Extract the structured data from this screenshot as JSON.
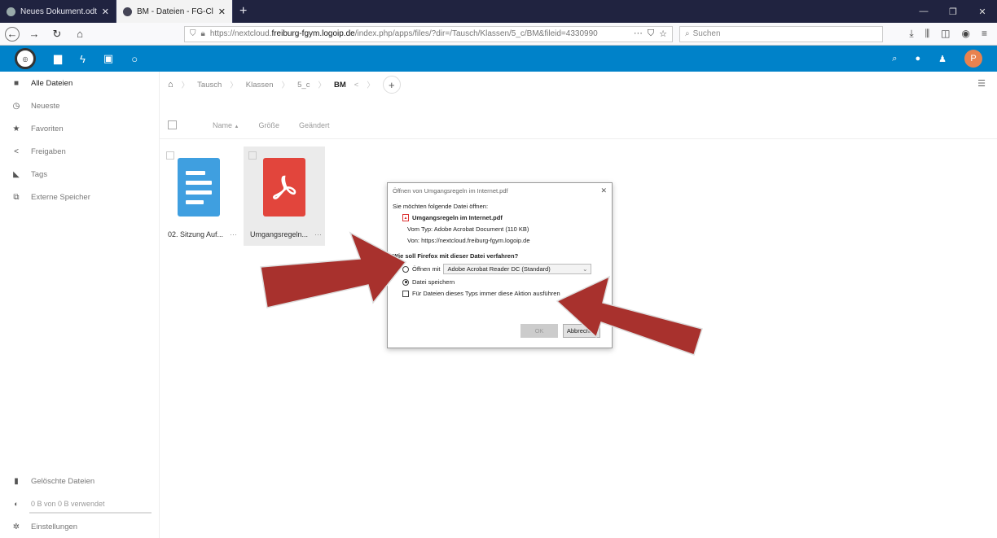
{
  "browser": {
    "tabs": [
      {
        "label": "Neues Dokument.odt - Dateien",
        "close": "✕",
        "active": false
      },
      {
        "label": "BM - Dateien - FG-Cloud",
        "close": "✕",
        "active": true
      }
    ],
    "new_tab": "+",
    "url_prefix": "https://nextcloud.",
    "url_host": "freiburg-fgym.logoip.de",
    "url_path": "/index.php/apps/files/?dir=/Tausch/Klassen/5_c/BM&fileid=4330990",
    "url_more": "···",
    "search_placeholder": "Suchen"
  },
  "sidebar": {
    "items": [
      {
        "label": "Alle Dateien",
        "icon": "folder-icon"
      },
      {
        "label": "Neueste",
        "icon": "clock-icon"
      },
      {
        "label": "Favoriten",
        "icon": "star-icon"
      },
      {
        "label": "Freigaben",
        "icon": "share-icon"
      },
      {
        "label": "Tags",
        "icon": "tag-icon"
      },
      {
        "label": "Externe Speicher",
        "icon": "external-storage-icon"
      }
    ],
    "deleted": "Gelöschte Dateien",
    "quota": "0 B von 0 B verwendet",
    "settings": "Einstellungen"
  },
  "header": {
    "avatar_initial": "P"
  },
  "breadcrumb": {
    "items": [
      "Tausch",
      "Klassen",
      "5_c",
      "BM"
    ],
    "add": "+"
  },
  "list": {
    "col_name": "Name",
    "col_name_sort": "▲",
    "col_size": "Größe",
    "col_modified": "Geändert"
  },
  "files": [
    {
      "name": "02. Sitzung Auf...",
      "dots": "···"
    },
    {
      "name": "Umgangsregeln...",
      "dots": "···"
    }
  ],
  "dialog": {
    "title": "Öffnen von Umgangsregeln im Internet.pdf",
    "close": "✕",
    "intro": "Sie möchten folgende Datei öffnen:",
    "filename": "Umgangsregeln im Internet.pdf",
    "type_line": "Vom Typ: Adobe Acrobat Document (110 KB)",
    "from_line": "Von: https://nextcloud.freiburg-fgym.logoip.de",
    "question": "Wie soll Firefox mit dieser Datei verfahren?",
    "open_with": "Öffnen mit",
    "app_option": "Adobe Acrobat Reader DC (Standard)",
    "save_file": "Datei speichern",
    "always": "Für Dateien dieses Typs immer diese Aktion ausführen",
    "ok": "OK",
    "cancel": "Abbrechen",
    "selected_option": "save_file"
  },
  "colors": {
    "header_blue": "#0082c9",
    "arrow_red": "#a8312d",
    "doc_blue": "#3f9fe0",
    "pdf_red": "#e2453c"
  }
}
